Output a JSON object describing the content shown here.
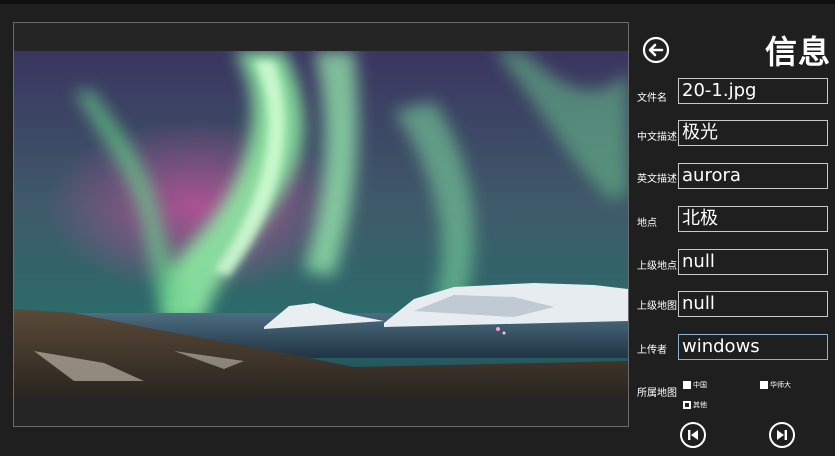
{
  "header": {
    "title": "信息",
    "back_icon": "back-arrow-icon"
  },
  "fields": [
    {
      "label": "文件名",
      "value": "20-1.jpg"
    },
    {
      "label": "中文描述",
      "value": "极光"
    },
    {
      "label": "英文描述",
      "value": "aurora"
    },
    {
      "label": "地点",
      "value": "北极"
    },
    {
      "label": "上级地点",
      "value": "null"
    },
    {
      "label": "上级地图",
      "value": "null"
    },
    {
      "label": "上传者",
      "value": "windows"
    }
  ],
  "maps": {
    "label": "所属地图",
    "options": [
      {
        "label": "中国",
        "checked": false
      },
      {
        "label": "华师大",
        "checked": false
      },
      {
        "label": "其他",
        "checked": true
      }
    ]
  },
  "nav": {
    "prev_icon": "skip-previous-icon",
    "next_icon": "skip-next-icon"
  },
  "photo": {
    "subject": "aurora-landscape"
  }
}
